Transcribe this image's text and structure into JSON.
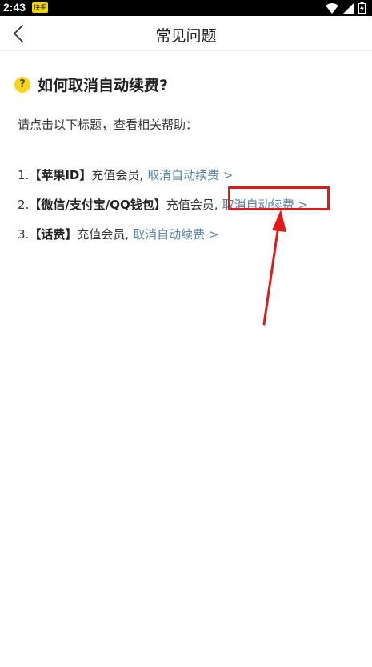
{
  "status_bar": {
    "time": "2:43",
    "badge": "快手"
  },
  "header": {
    "title": "常见问题"
  },
  "question": {
    "icon": "?",
    "title": "如何取消自动续费?"
  },
  "intro": "请点击以下标题，查看相关帮助：",
  "items": [
    {
      "number": "1.",
      "platform": "【苹果ID】",
      "text": "充值会员,",
      "link": "取消自动续费 >"
    },
    {
      "number": "2.",
      "platform": "【微信/支付宝/QQ钱包】",
      "text": "充值会员,",
      "link": "取消自动续费 >"
    },
    {
      "number": "3.",
      "platform": "【话费】",
      "text": "充值会员,",
      "link": "取消自动续费 >"
    }
  ],
  "colors": {
    "accent_yellow": "#f7d61d",
    "link_blue": "#5b80a8",
    "annotation_red": "#e01a1a"
  }
}
